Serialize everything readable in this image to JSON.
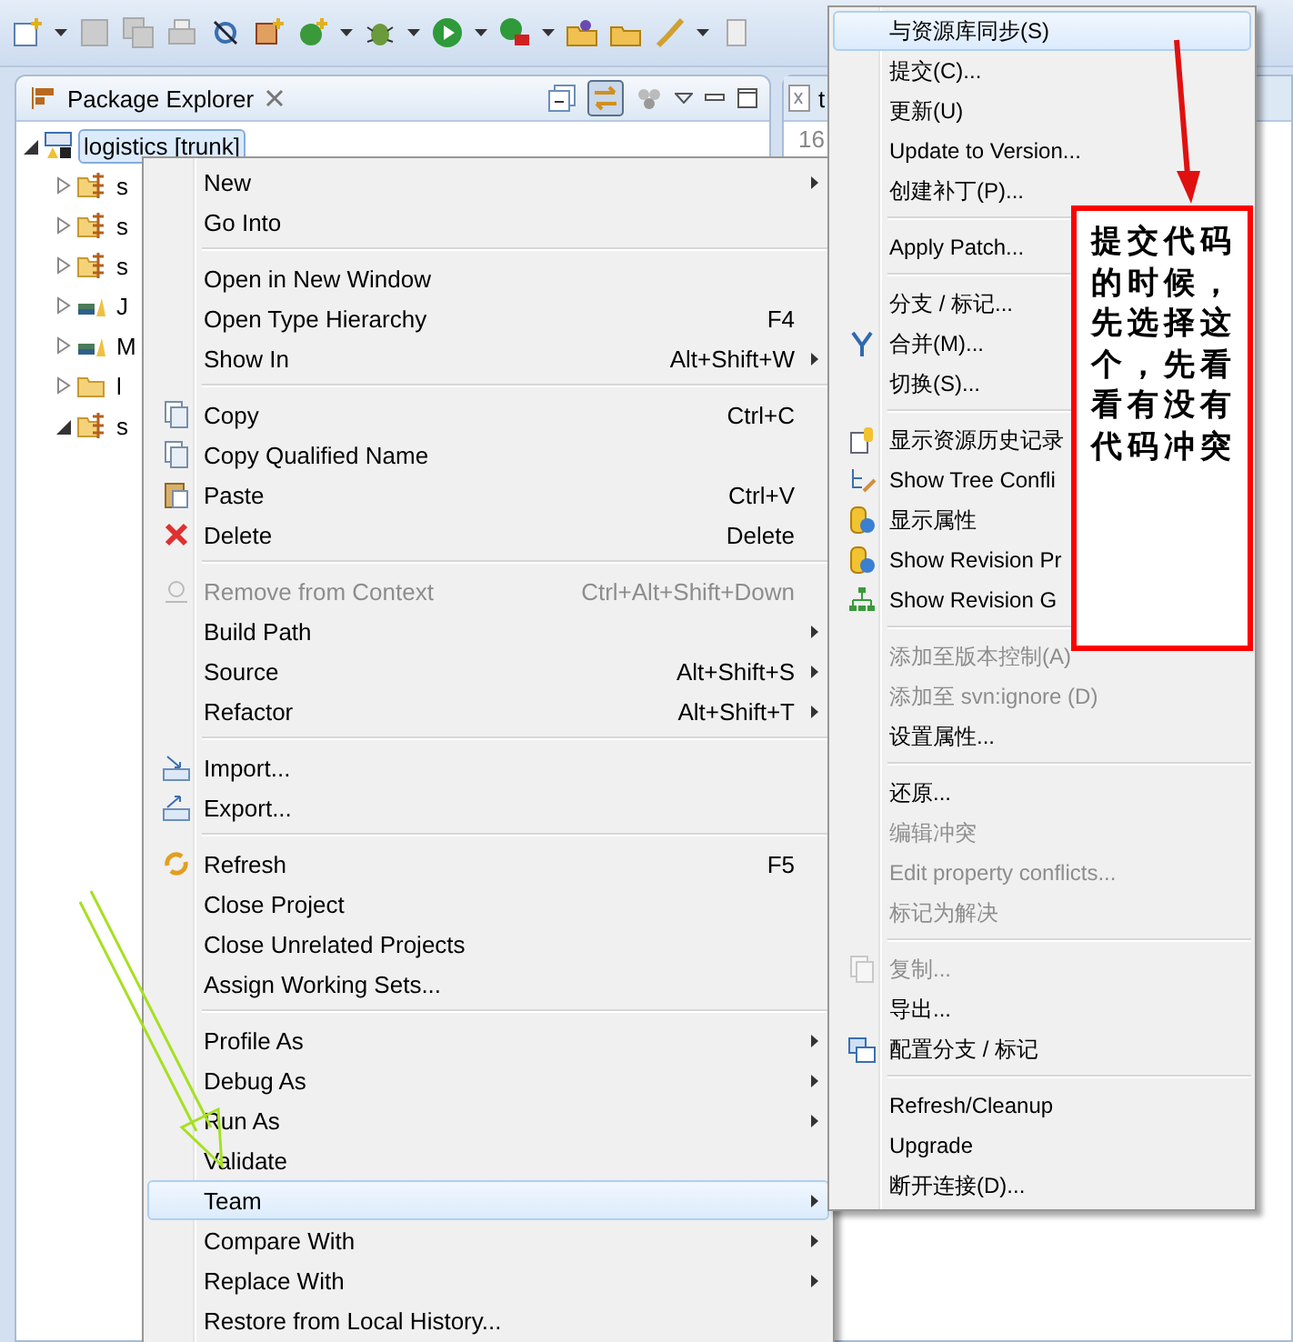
{
  "package_explorer": {
    "title": "Package Explorer",
    "tree": [
      {
        "label": "logistics [trunk]",
        "selected": true,
        "expanded": true,
        "children": [
          {
            "label": "s",
            "expanded": false
          },
          {
            "label": "s",
            "expanded": false
          },
          {
            "label": "s",
            "expanded": false
          },
          {
            "label": "J",
            "expanded": false
          },
          {
            "label": "M",
            "expanded": false
          },
          {
            "label": "l",
            "expanded": false
          },
          {
            "label": "s",
            "expanded": true
          }
        ]
      }
    ]
  },
  "editor": {
    "tab_label": "t",
    "line_number": "16"
  },
  "context_menu": {
    "items": [
      {
        "kind": "item",
        "label": "New",
        "submenu": true,
        "selected": false,
        "disabled": false
      },
      {
        "kind": "item",
        "label": "Go Into",
        "submenu": false,
        "selected": false,
        "disabled": false
      },
      {
        "kind": "separator"
      },
      {
        "kind": "item",
        "label": "Open in New Window",
        "submenu": false,
        "selected": false,
        "disabled": false
      },
      {
        "kind": "item",
        "label": "Open Type Hierarchy",
        "shortcut": "F4",
        "submenu": false,
        "selected": false,
        "disabled": false
      },
      {
        "kind": "item",
        "label": "Show In",
        "shortcut": "Alt+Shift+W",
        "submenu": true,
        "selected": false,
        "disabled": false
      },
      {
        "kind": "separator"
      },
      {
        "kind": "item",
        "label": "Copy",
        "shortcut": "Ctrl+C",
        "submenu": false,
        "selected": false,
        "disabled": false
      },
      {
        "kind": "item",
        "label": "Copy Qualified Name",
        "submenu": false,
        "selected": false,
        "disabled": false
      },
      {
        "kind": "item",
        "label": "Paste",
        "shortcut": "Ctrl+V",
        "submenu": false,
        "selected": false,
        "disabled": false
      },
      {
        "kind": "item",
        "label": "Delete",
        "shortcut": "Delete",
        "submenu": false,
        "selected": false,
        "disabled": false
      },
      {
        "kind": "separator"
      },
      {
        "kind": "item",
        "label": "Remove from Context",
        "shortcut": "Ctrl+Alt+Shift+Down",
        "submenu": false,
        "selected": false,
        "disabled": true
      },
      {
        "kind": "item",
        "label": "Build Path",
        "submenu": true,
        "selected": false,
        "disabled": false
      },
      {
        "kind": "item",
        "label": "Source",
        "shortcut": "Alt+Shift+S",
        "submenu": true,
        "selected": false,
        "disabled": false
      },
      {
        "kind": "item",
        "label": "Refactor",
        "shortcut": "Alt+Shift+T",
        "submenu": true,
        "selected": false,
        "disabled": false
      },
      {
        "kind": "separator"
      },
      {
        "kind": "item",
        "label": "Import...",
        "submenu": false,
        "selected": false,
        "disabled": false
      },
      {
        "kind": "item",
        "label": "Export...",
        "submenu": false,
        "selected": false,
        "disabled": false
      },
      {
        "kind": "separator"
      },
      {
        "kind": "item",
        "label": "Refresh",
        "shortcut": "F5",
        "submenu": false,
        "selected": false,
        "disabled": false
      },
      {
        "kind": "item",
        "label": "Close Project",
        "submenu": false,
        "selected": false,
        "disabled": false
      },
      {
        "kind": "item",
        "label": "Close Unrelated Projects",
        "submenu": false,
        "selected": false,
        "disabled": false
      },
      {
        "kind": "item",
        "label": "Assign Working Sets...",
        "submenu": false,
        "selected": false,
        "disabled": false
      },
      {
        "kind": "separator"
      },
      {
        "kind": "item",
        "label": "Profile As",
        "submenu": true,
        "selected": false,
        "disabled": false
      },
      {
        "kind": "item",
        "label": "Debug As",
        "submenu": true,
        "selected": false,
        "disabled": false
      },
      {
        "kind": "item",
        "label": "Run As",
        "submenu": true,
        "selected": false,
        "disabled": false
      },
      {
        "kind": "item",
        "label": "Validate",
        "submenu": false,
        "selected": false,
        "disabled": false
      },
      {
        "kind": "item",
        "label": "Team",
        "submenu": true,
        "selected": true,
        "disabled": false
      },
      {
        "kind": "item",
        "label": "Compare With",
        "submenu": true,
        "selected": false,
        "disabled": false
      },
      {
        "kind": "item",
        "label": "Replace With",
        "submenu": true,
        "selected": false,
        "disabled": false
      },
      {
        "kind": "item",
        "label": "Restore from Local History...",
        "submenu": false,
        "selected": false,
        "disabled": false
      }
    ]
  },
  "team_menu": {
    "items": [
      {
        "kind": "item",
        "label": "与资源库同步(S)",
        "selected": true,
        "disabled": false
      },
      {
        "kind": "item",
        "label": "提交(C)...",
        "selected": false,
        "disabled": false
      },
      {
        "kind": "item",
        "label": "更新(U)",
        "selected": false,
        "disabled": false
      },
      {
        "kind": "item",
        "label": "Update to Version...",
        "selected": false,
        "disabled": false
      },
      {
        "kind": "item",
        "label": "创建补丁(P)...",
        "selected": false,
        "disabled": false
      },
      {
        "kind": "separator"
      },
      {
        "kind": "item",
        "label": "Apply Patch...",
        "selected": false,
        "disabled": false
      },
      {
        "kind": "separator"
      },
      {
        "kind": "item",
        "label": "分支 / 标记...",
        "selected": false,
        "disabled": false
      },
      {
        "kind": "item",
        "label": "合并(M)...",
        "selected": false,
        "disabled": false
      },
      {
        "kind": "item",
        "label": "切换(S)...",
        "selected": false,
        "disabled": false
      },
      {
        "kind": "separator"
      },
      {
        "kind": "item",
        "label": "显示资源历史记录",
        "selected": false,
        "disabled": false
      },
      {
        "kind": "item",
        "label": "Show Tree Confli",
        "selected": false,
        "disabled": false
      },
      {
        "kind": "item",
        "label": "显示属性",
        "selected": false,
        "disabled": false
      },
      {
        "kind": "item",
        "label": "Show Revision Pr",
        "selected": false,
        "disabled": false
      },
      {
        "kind": "item",
        "label": "Show Revision G",
        "selected": false,
        "disabled": false
      },
      {
        "kind": "separator"
      },
      {
        "kind": "item",
        "label": "添加至版本控制(A)",
        "selected": false,
        "disabled": true
      },
      {
        "kind": "item",
        "label": "添加至 svn:ignore (D)",
        "selected": false,
        "disabled": true
      },
      {
        "kind": "item",
        "label": "设置属性...",
        "selected": false,
        "disabled": false
      },
      {
        "kind": "separator"
      },
      {
        "kind": "item",
        "label": "还原...",
        "selected": false,
        "disabled": false
      },
      {
        "kind": "item",
        "label": "编辑冲突",
        "selected": false,
        "disabled": true
      },
      {
        "kind": "item",
        "label": "Edit property conflicts...",
        "selected": false,
        "disabled": true
      },
      {
        "kind": "item",
        "label": "标记为解决",
        "selected": false,
        "disabled": true
      },
      {
        "kind": "separator"
      },
      {
        "kind": "item",
        "label": "复制...",
        "selected": false,
        "disabled": true
      },
      {
        "kind": "item",
        "label": "导出...",
        "selected": false,
        "disabled": false
      },
      {
        "kind": "item",
        "label": "配置分支 / 标记",
        "selected": false,
        "disabled": false
      },
      {
        "kind": "separator"
      },
      {
        "kind": "item",
        "label": "Refresh/Cleanup",
        "selected": false,
        "disabled": false
      },
      {
        "kind": "item",
        "label": "Upgrade",
        "selected": false,
        "disabled": false
      },
      {
        "kind": "item",
        "label": "断开连接(D)...",
        "selected": false,
        "disabled": false
      }
    ]
  },
  "annotation": {
    "text": "提交代码的时候，先选择这个，先看看有没有代码冲突"
  }
}
